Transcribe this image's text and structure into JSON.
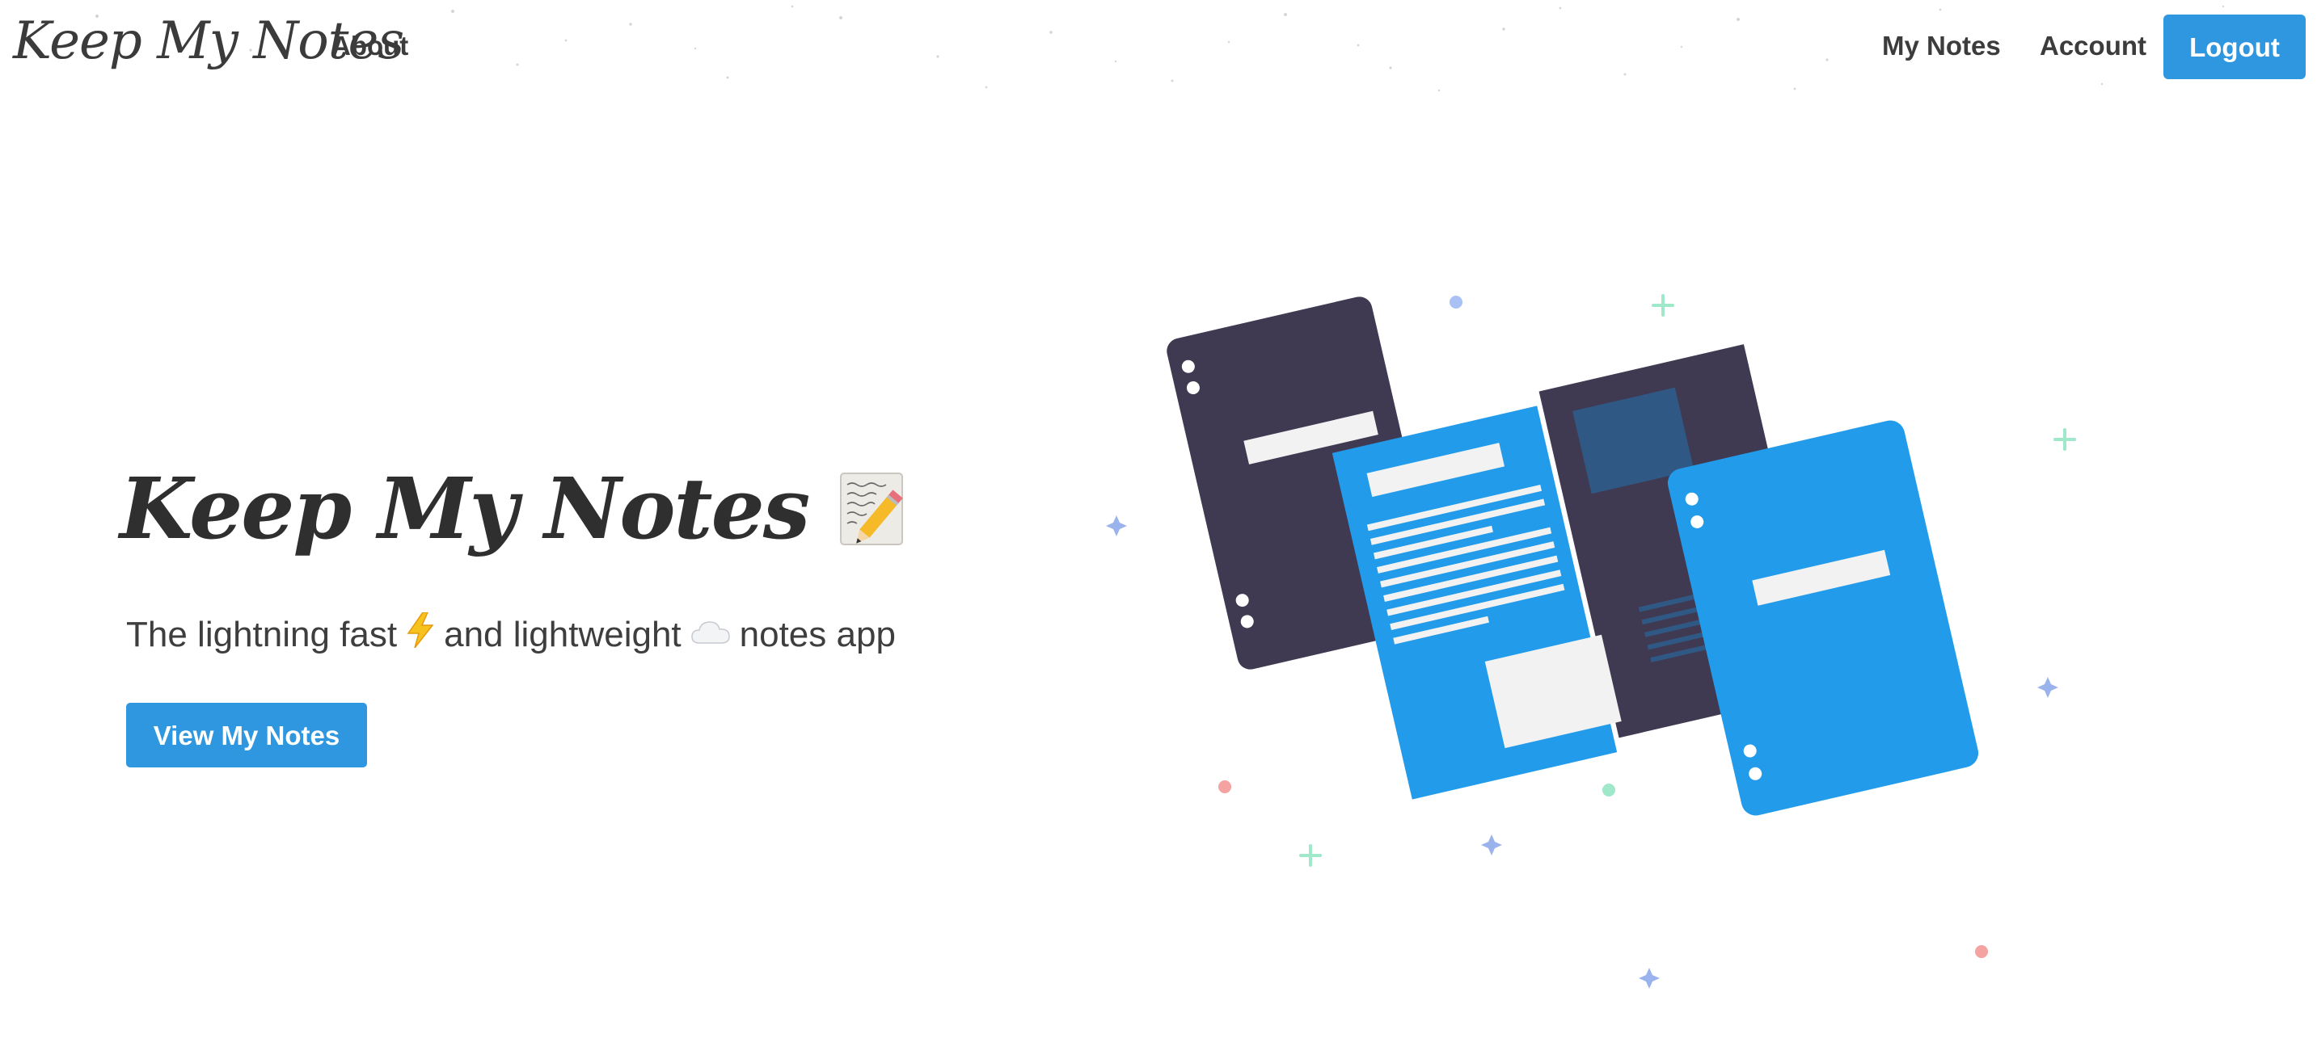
{
  "navbar": {
    "brand": "Keep My Notes",
    "about_label": "About",
    "my_notes_label": "My Notes",
    "account_label": "Account",
    "logout_label": "Logout"
  },
  "hero": {
    "title": "Keep My Notes",
    "title_emoji_icon": "memo-pencil-icon",
    "subtitle": {
      "part1": "The lightning fast",
      "emoji1": "⚡",
      "part2": "and lightweight",
      "emoji2_icon": "cloud-icon",
      "part3": "notes app"
    },
    "cta_label": "View My Notes"
  },
  "illustration": {
    "icon": "notebooks-illustration",
    "colors": {
      "dark": "#3f3a52",
      "blue": "#229bea",
      "paper": "#f2f2f2"
    }
  },
  "colors": {
    "accent": "#2f97e0",
    "text": "#3a3a3a"
  }
}
